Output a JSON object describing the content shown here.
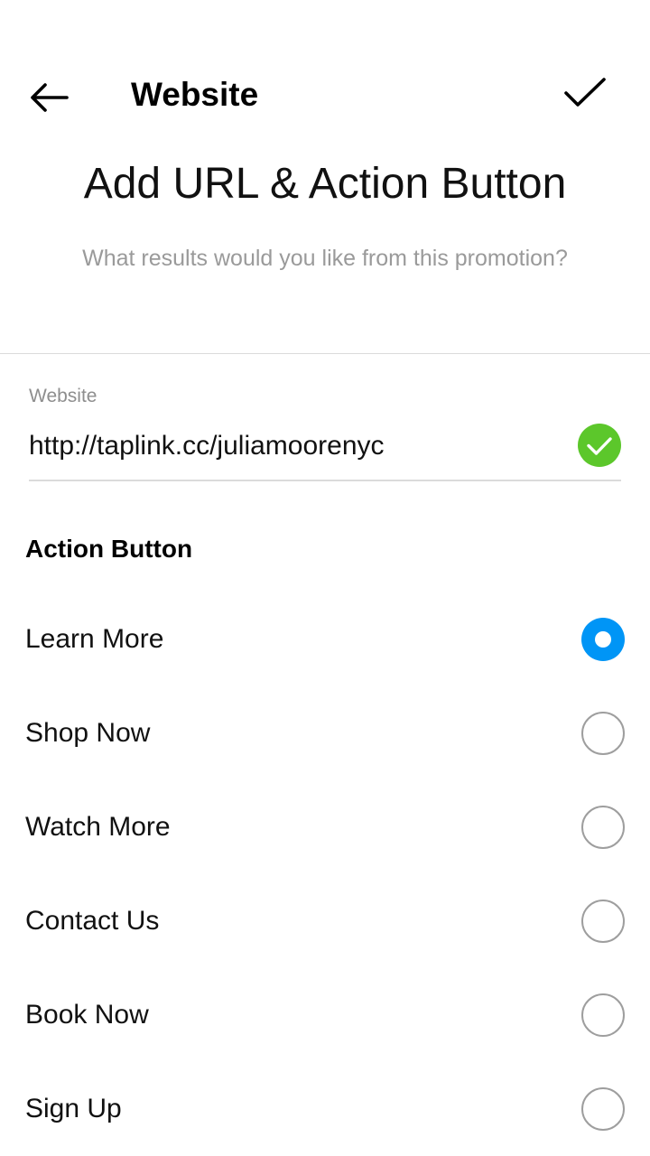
{
  "header": {
    "title": "Website",
    "back_icon": "arrow-left-icon",
    "confirm_icon": "checkmark-icon"
  },
  "main": {
    "title": "Add URL & Action Button",
    "subtitle": "What results would you like from this promotion?"
  },
  "website_field": {
    "label": "Website",
    "value": "http://taplink.cc/juliamoorenyc",
    "status_icon": "valid-check-icon",
    "status_color": "#5cc72b"
  },
  "action_button": {
    "title": "Action Button",
    "selected_index": 0,
    "accent_color": "#0095f6",
    "options": [
      {
        "label": "Learn More"
      },
      {
        "label": "Shop Now"
      },
      {
        "label": "Watch More"
      },
      {
        "label": "Contact Us"
      },
      {
        "label": "Book Now"
      },
      {
        "label": "Sign Up"
      }
    ]
  }
}
